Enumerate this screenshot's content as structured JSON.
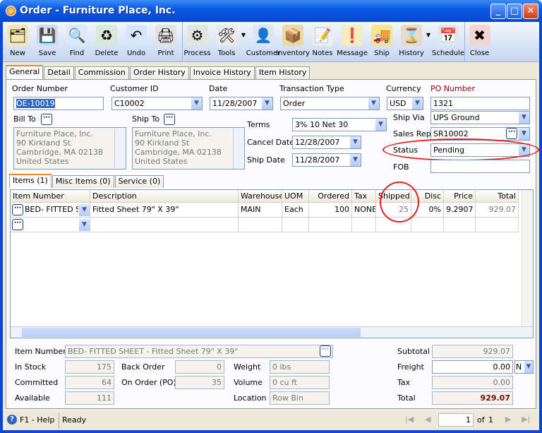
{
  "window": {
    "title": "Order - Furniture Place, Inc."
  },
  "toolbar": [
    {
      "label": "New",
      "icon": "new-icon",
      "glyph": "🗂",
      "color": "#f3e6b0"
    },
    {
      "label": "Save",
      "icon": "save-icon",
      "glyph": "💾",
      "color": "#d5d8f2"
    },
    {
      "label": "Find",
      "icon": "binoculars-icon",
      "glyph": "🔍",
      "color": "#dce9f9"
    },
    {
      "label": "Delete",
      "icon": "recycle-bin-icon",
      "glyph": "♻",
      "color": "#d9e9d9"
    },
    {
      "label": "Undo",
      "icon": "undo-icon",
      "glyph": "↶",
      "color": "#d8e6fb"
    },
    {
      "label": "Print",
      "icon": "printer-icon",
      "glyph": "🖨",
      "color": "#e2e2e2"
    },
    {
      "label": "Process",
      "icon": "process-icon",
      "glyph": "⚙",
      "color": "#e0e6e0",
      "sep": true
    },
    {
      "label": "Tools",
      "icon": "tools-icon",
      "glyph": "🛠",
      "color": "#eaeaea",
      "dropdown": true
    },
    {
      "label": "Customer",
      "icon": "customer-icon",
      "glyph": "👤",
      "color": "#dbe6f8"
    },
    {
      "label": "Inventory",
      "icon": "inventory-boxes-icon",
      "glyph": "📦",
      "color": "#ecd9a8"
    },
    {
      "label": "Notes",
      "icon": "notes-icon",
      "glyph": "📝",
      "color": "#eeeeee"
    },
    {
      "label": "Message",
      "icon": "message-icon",
      "glyph": "❗",
      "color": "#f5ecc0"
    },
    {
      "label": "Ship",
      "icon": "forklift-icon",
      "glyph": "🚚",
      "color": "#f6e58a"
    },
    {
      "label": "History",
      "icon": "history-icon",
      "glyph": "⌛",
      "color": "#e7ddc6",
      "dropdown": true
    },
    {
      "label": "Schedule",
      "icon": "schedule-icon",
      "glyph": "📅",
      "color": "#dbe9f0"
    },
    {
      "label": "Close",
      "icon": "close-form-icon",
      "glyph": "✖",
      "color": "#f1d6d2",
      "sep": true
    }
  ],
  "tabs": [
    "General",
    "Detail",
    "Commission",
    "Order History",
    "Invoice History",
    "Item History"
  ],
  "header": {
    "order_number_label": "Order Number",
    "order_number": "OE-10019",
    "customer_id_label": "Customer ID",
    "customer_id": "C10002",
    "date_label": "Date",
    "date": "11/28/2007",
    "transaction_type_label": "Transaction Type",
    "transaction_type": "Order",
    "currency_label": "Currency",
    "currency": "USD",
    "po_number_label": "PO Number",
    "po_number": "1321",
    "bill_to_label": "Bill To",
    "ship_to_label": "Ship To",
    "bill_to": [
      "Furniture Place, Inc.",
      "90 Kirkland St",
      "Cambridge, MA 02138",
      "United States"
    ],
    "ship_to": [
      "Furniture Place, Inc.",
      "90 Kirkland St",
      "Cambridge, MA 02138",
      "United States"
    ],
    "terms_label": "Terms",
    "terms": "3% 10 Net 30",
    "cancel_date_label": "Cancel Date",
    "cancel_date": "12/28/2007",
    "ship_date_label": "Ship Date",
    "ship_date": "11/28/2007",
    "ship_via_label": "Ship Via",
    "ship_via": "UPS Ground",
    "sales_rep_label": "Sales Rep",
    "sales_rep": "SR10002",
    "status_label": "Status",
    "status": "Pending",
    "fob_label": "FOB",
    "fob": ""
  },
  "subtabs": [
    "Items (1)",
    "Misc Items (0)",
    "Service (0)"
  ],
  "grid": {
    "columns": [
      "Item Number",
      "Description",
      "Warehouse",
      "UOM",
      "Ordered",
      "Tax",
      "Shipped",
      "Disc",
      "Price",
      "Total"
    ],
    "rows": [
      [
        "BED- FITTED SH",
        "Fitted Sheet 79\" X 39\"",
        "MAIN",
        "Each",
        "100",
        "NONE",
        "25",
        "0%",
        "9.2907",
        "929.07"
      ]
    ]
  },
  "footer": {
    "item_number_label": "Item Number",
    "item_number": "BED- FITTED SHEET - Fitted Sheet 79\" X 39\"",
    "in_stock_label": "In Stock",
    "in_stock": "175",
    "committed_label": "Committed",
    "committed": "64",
    "available_label": "Available",
    "available": "111",
    "back_order_label": "Back Order",
    "back_order": "0",
    "on_order_label": "On Order (PO)",
    "on_order": "35",
    "weight_label": "Weight",
    "weight": "0 lbs",
    "volume_label": "Volume",
    "volume": "0 cu ft",
    "location_label": "Location",
    "location": "Row  Bin",
    "subtotal_label": "Subtotal",
    "subtotal": "929.07",
    "freight_label": "Freight",
    "freight": "0.00",
    "freight_tax": "N",
    "tax_label": "Tax",
    "tax": "0.00",
    "total_label": "Total",
    "total": "929.07"
  },
  "statusbar": {
    "help": "F1 - Help",
    "status": "Ready",
    "page": "1",
    "of": "of",
    "pages": "1"
  },
  "colors": {
    "po_label": "#8b0000",
    "total": "#800000",
    "highlight_circle": "#e51d1d"
  }
}
